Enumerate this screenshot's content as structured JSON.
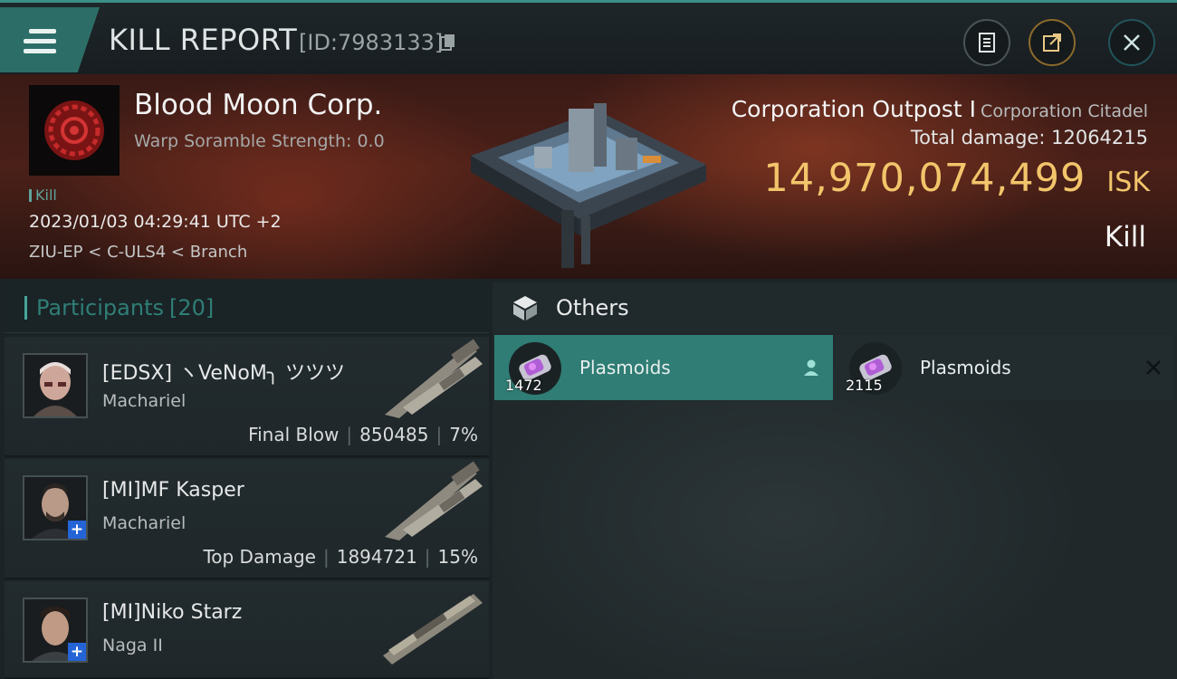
{
  "header": {
    "title": "KILL REPORT",
    "report_id": "[ID:7983133]"
  },
  "victim": {
    "corporation": "Blood Moon Corp.",
    "warp_scramble": "Warp Soramble Strength: 0.0",
    "tag": "Kill",
    "datetime": "2023/01/03 04:29:41 UTC +2",
    "location": "ZIU-EP < C-ULS4 < Branch"
  },
  "target": {
    "name": "Corporation Outpost I",
    "type": "Corporation Citadel",
    "total_damage_label": "Total damage:",
    "total_damage": "12064215",
    "isk_value": "14,970,074,499",
    "isk_unit": "ISK",
    "result": "Kill"
  },
  "participants": {
    "label": "Participants",
    "count": "[20]",
    "rows": [
      {
        "name": "[EDSX] ヽVeNoM╮ ツツツ",
        "ship": "Machariel",
        "role": "Final Blow",
        "damage": "850485",
        "percent": "7%",
        "plus": false
      },
      {
        "name": "[MI]MF Kasper",
        "ship": "Machariel",
        "role": "Top Damage",
        "damage": "1894721",
        "percent": "15%",
        "plus": true
      },
      {
        "name": "[MI]Niko Starz",
        "ship": "Naga II",
        "role": "",
        "damage": "",
        "percent": "",
        "plus": true
      }
    ]
  },
  "others": {
    "label": "Others",
    "items": [
      {
        "name": "Plasmoids",
        "qty": "1472",
        "selected": true
      },
      {
        "name": "Plasmoids",
        "qty": "2115",
        "selected": false
      }
    ]
  },
  "colors": {
    "accent_teal": "#2f7d74",
    "isk_gold": "#f3c56b",
    "banner_red": "#4a2018"
  },
  "icons": [
    "hamburger-menu-icon",
    "copy-icon",
    "clipboard-icon",
    "share-icon",
    "close-icon",
    "corp-emblem-icon",
    "cube-icon",
    "person-icon",
    "x-icon",
    "plasmoid-canister-icon"
  ]
}
